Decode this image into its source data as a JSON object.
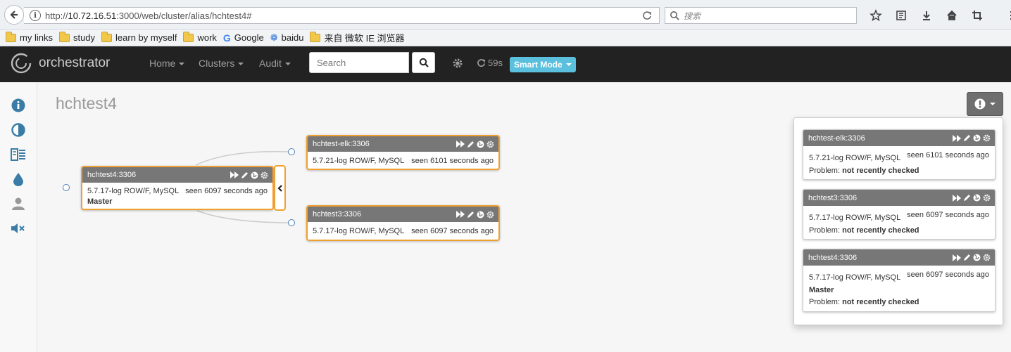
{
  "browser": {
    "url_prefix": "http://",
    "url_host": "10.72.16.51",
    "url_rest": ":3000/web/cluster/alias/hchtest4#",
    "search_placeholder": "搜索",
    "bookmarks": [
      {
        "label": "my links",
        "icon": "folder-icon"
      },
      {
        "label": "study",
        "icon": "folder-icon"
      },
      {
        "label": "learn by myself",
        "icon": "folder-icon"
      },
      {
        "label": "work",
        "icon": "folder-icon"
      },
      {
        "label": "Google",
        "icon": "google-icon"
      },
      {
        "label": "baidu",
        "icon": "baidu-icon"
      },
      {
        "label": "来自 微软 IE 浏览器",
        "icon": "folder-icon"
      }
    ]
  },
  "navbar": {
    "brand": "orchestrator",
    "menus": [
      "Home",
      "Clusters",
      "Audit"
    ],
    "search_placeholder": "Search",
    "refresh_countdown": "59s",
    "mode_label": "Smart Mode"
  },
  "sidebar": {
    "icons": [
      "info-icon",
      "contrast-icon",
      "hosts-icon",
      "water-drop-icon",
      "user-icon",
      "volume-off-icon"
    ]
  },
  "page": {
    "title": "hchtest4"
  },
  "topology": {
    "master": {
      "name": "hchtest4:3306",
      "version": "5.7.17-log ROW/F, MySQL",
      "seen": "seen 6097 seconds ago",
      "role": "Master"
    },
    "replicas": [
      {
        "name": "hchtest-elk:3306",
        "version": "5.7.21-log ROW/F, MySQL",
        "seen": "seen 6101 seconds ago"
      },
      {
        "name": "hchtest3:3306",
        "version": "5.7.17-log ROW/F, MySQL",
        "seen": "seen 6097 seconds ago"
      }
    ]
  },
  "problems": {
    "problem_label": "Problem:",
    "items": [
      {
        "name": "hchtest-elk:3306",
        "version": "5.7.21-log ROW/F, MySQL",
        "seen": "seen 6101 seconds ago",
        "role": "",
        "problem": "not recently checked"
      },
      {
        "name": "hchtest3:3306",
        "version": "5.7.17-log ROW/F, MySQL",
        "seen": "seen 6097 seconds ago",
        "role": "",
        "problem": "not recently checked"
      },
      {
        "name": "hchtest4:3306",
        "version": "5.7.17-log ROW/F, MySQL",
        "seen": "seen 6097 seconds ago",
        "role": "Master",
        "problem": "not recently checked"
      }
    ]
  },
  "colors": {
    "navbar_bg": "#222222",
    "instance_border": "#f0a030",
    "instance_header": "#777777",
    "smart_mode": "#5bc0de",
    "sidebar_icon": "#3a7ca5"
  }
}
